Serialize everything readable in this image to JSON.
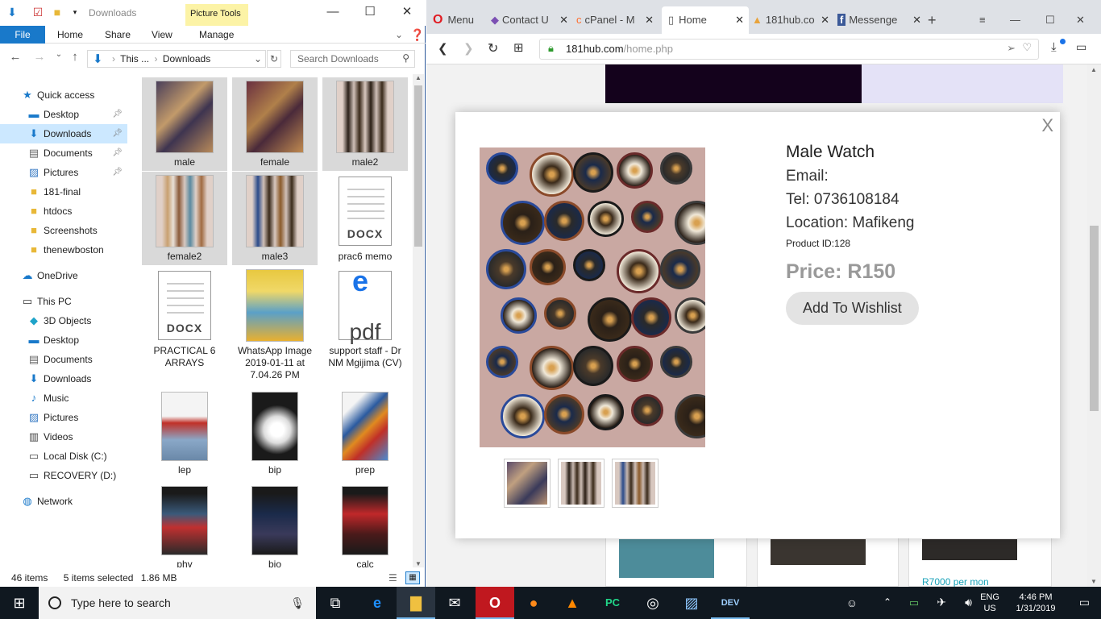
{
  "explorer": {
    "title": "Downloads",
    "picture_tools": "Picture Tools",
    "ribbon_tabs": {
      "file": "File",
      "home": "Home",
      "share": "Share",
      "view": "View",
      "manage": "Manage"
    },
    "address": {
      "root": "This ...",
      "folder": "Downloads"
    },
    "search_placeholder": "Search Downloads",
    "tree": {
      "quick_access": "Quick access",
      "items": [
        "Desktop",
        "Downloads",
        "Documents",
        "Pictures",
        "181-final",
        "htdocs",
        "Screenshots",
        "thenewboston"
      ],
      "onedrive": "OneDrive",
      "this_pc": "This PC",
      "pc_items": [
        "3D Objects",
        "Desktop",
        "Documents",
        "Downloads",
        "Music",
        "Pictures",
        "Videos",
        "Local Disk (C:)",
        "RECOVERY (D:)"
      ],
      "network": "Network"
    },
    "files": [
      {
        "name": "male"
      },
      {
        "name": "female"
      },
      {
        "name": "male2"
      },
      {
        "name": "female2"
      },
      {
        "name": "male3"
      },
      {
        "name": "prac6 memo",
        "type": "DOCX"
      },
      {
        "name": "PRACTICAL 6 ARRAYS",
        "type": "DOCX"
      },
      {
        "name": "WhatsApp Image 2019-01-11 at 7.04.26 PM"
      },
      {
        "name": "support staff - Dr NM Mgijima (CV)",
        "type": "pdf"
      },
      {
        "name": "lep"
      },
      {
        "name": "bip"
      },
      {
        "name": "prep"
      },
      {
        "name": "phy"
      },
      {
        "name": "bio"
      },
      {
        "name": "calc"
      }
    ],
    "status": {
      "count": "46 items",
      "selected": "5 items selected",
      "size": "1.86 MB"
    }
  },
  "browser": {
    "tabs": {
      "menu": "Menu",
      "contact": "Contact U",
      "cpanel": "cPanel - M",
      "home": "Home",
      "hub": "181hub.co",
      "messenger": "Messenge"
    },
    "url_host": "181hub.com",
    "url_path": "/home.php",
    "modal": {
      "title": "Male Watch",
      "email": "Email:",
      "tel": "Tel: 0736108184",
      "location": "Location: Mafikeng",
      "product_id": "Product ID:128",
      "price": "Price: R150",
      "wishlist": "Add To Wishlist",
      "close": "X"
    },
    "bg_price": "R7000 per mon"
  },
  "taskbar": {
    "search_placeholder": "Type here to search",
    "lang": "ENG",
    "region": "US",
    "time": "4:46 PM",
    "date": "1/31/2019"
  }
}
